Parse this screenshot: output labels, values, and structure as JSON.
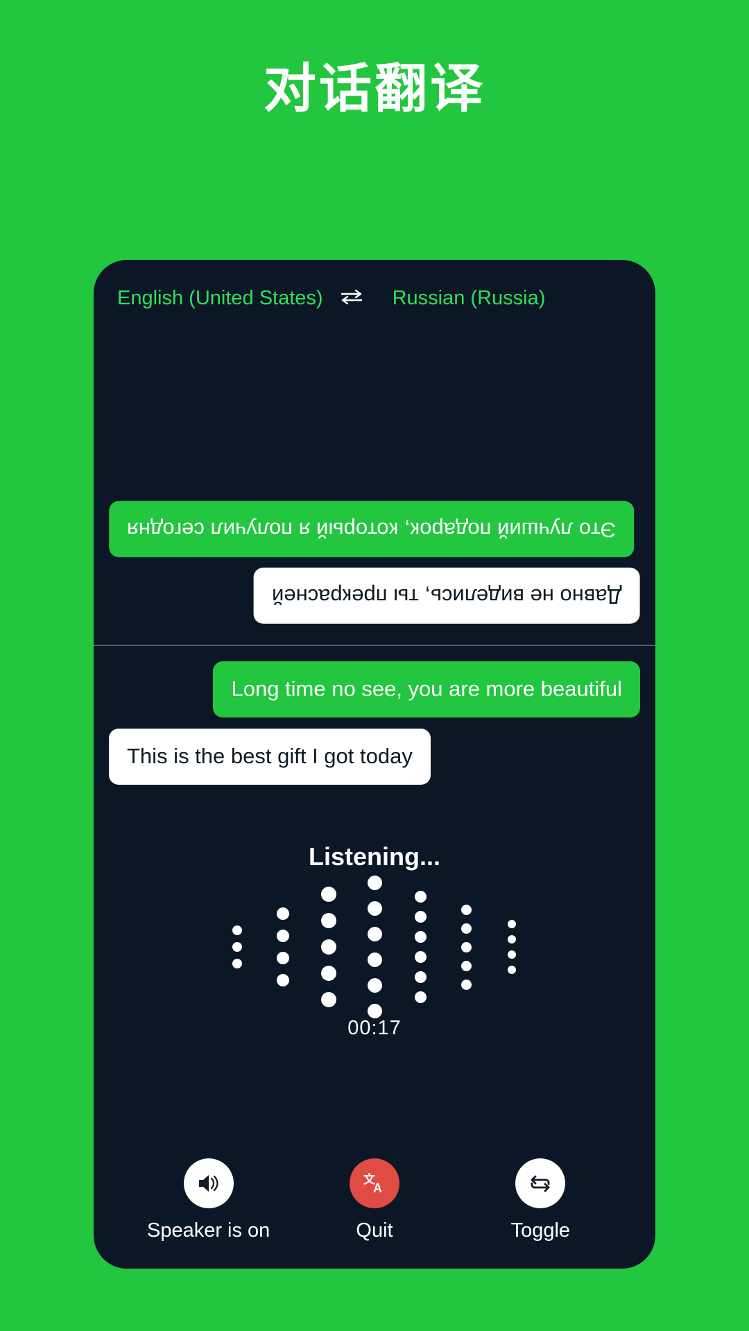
{
  "page": {
    "title": "对话翻译",
    "background_color": "#22c63f",
    "device_background_color": "#0b1726"
  },
  "languages": {
    "source": "English (United States)",
    "target": "Russian (Russia)",
    "swap_icon": "swap-horizontal-icon",
    "swap_glyph": "⇌",
    "text_color": "#2ee05a"
  },
  "conversation": {
    "top_panel_rotated": true,
    "top_messages": [
      {
        "text": "Это лучший подарок, который я получил сегодня",
        "style": "green",
        "align": "left"
      },
      {
        "text": "Давно не виделись, ты прекрасней",
        "style": "white",
        "align": "right"
      }
    ],
    "bottom_messages": [
      {
        "text": "Long time no see, you are more beautiful",
        "style": "green",
        "align": "right"
      },
      {
        "text": "This is the best gift I got today",
        "style": "white",
        "align": "left"
      }
    ]
  },
  "listening": {
    "status_text": "Listening...",
    "timer": "00:17",
    "waveform": {
      "columns": [
        {
          "dots": 3,
          "size": 14
        },
        {
          "dots": 4,
          "size": 18
        },
        {
          "dots": 5,
          "size": 22
        },
        {
          "dots": 6,
          "size": 21
        },
        {
          "dots": 6,
          "size": 17
        },
        {
          "dots": 5,
          "size": 15
        },
        {
          "dots": 4,
          "size": 12
        }
      ],
      "dot_color": "#ffffff"
    }
  },
  "controls": [
    {
      "label": "Speaker is on",
      "icon": "speaker-on-icon",
      "glyph": "🔊",
      "circle_color": "#ffffff",
      "glyph_color": "#121c26"
    },
    {
      "label": "Quit",
      "icon": "translate-icon",
      "glyph": "文A",
      "circle_color": "#e04b44",
      "glyph_color": "#ffffff"
    },
    {
      "label": "Toggle",
      "icon": "toggle-swap-icon",
      "glyph": "⇄",
      "circle_color": "#ffffff",
      "glyph_color": "#121c26"
    }
  ]
}
